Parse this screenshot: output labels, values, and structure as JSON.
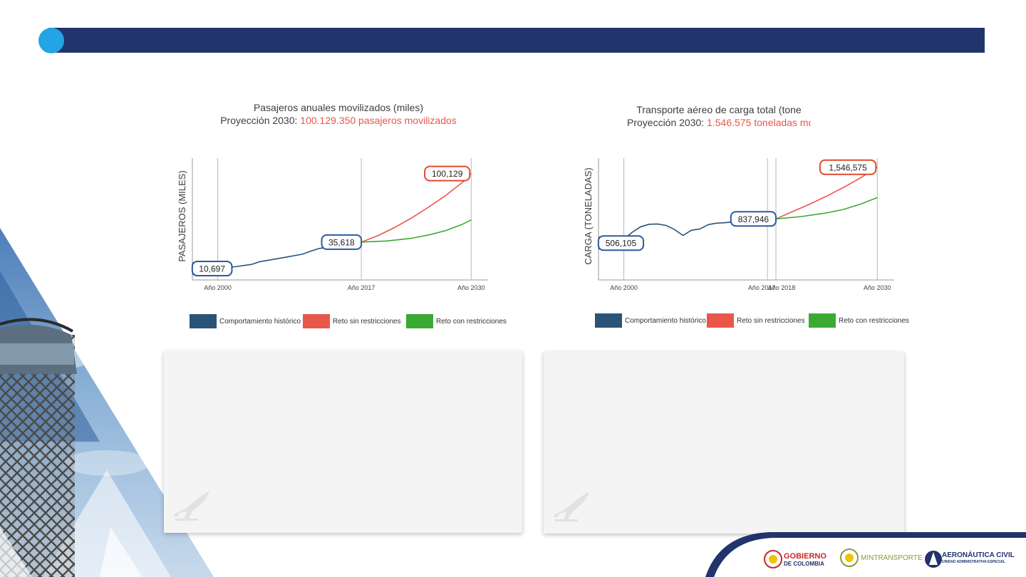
{
  "colors": {
    "header": "#21346b",
    "header_dot": "#23a4e4",
    "historic": "#2a5378",
    "unrestricted": "#e8574a",
    "restricted": "#3aaa35",
    "label_border_blue": "#2c5aa0",
    "label_border_red": "#e04a2e"
  },
  "chart_data": [
    {
      "type": "line",
      "title": "Pasajeros anuales movilizados (miles)",
      "subtitle_prefix": "Proyección 2030: ",
      "subtitle_highlight": "100.129.350 pasajeros movilizados",
      "ylabel": "PASAJEROS (MILES)",
      "xlabel": "",
      "x_ticks": [
        "Año 2000",
        "Año 2017",
        "Año 2030"
      ],
      "xlim": [
        1997,
        2032
      ],
      "ylim": [
        0,
        120000
      ],
      "series": [
        {
          "name": "Comportamiento histórico",
          "color": "#2a5378",
          "x": [
            1998,
            2000,
            2002,
            2004,
            2005,
            2006,
            2008,
            2010,
            2011,
            2012,
            2013,
            2014,
            2015,
            2016,
            2017
          ],
          "values": [
            10697,
            10900,
            12400,
            14600,
            17200,
            18600,
            21300,
            24200,
            27100,
            29600,
            30800,
            32300,
            33500,
            34600,
            35618
          ]
        },
        {
          "name": "Reto sin restricciones",
          "color": "#e8574a",
          "x": [
            2017,
            2019,
            2021,
            2023,
            2025,
            2027,
            2029,
            2030
          ],
          "values": [
            35618,
            41800,
            49600,
            58600,
            68700,
            79600,
            92000,
            100129
          ]
        },
        {
          "name": "Reto con restricciones",
          "color": "#3aaa35",
          "x": [
            2017,
            2020,
            2023,
            2025,
            2027,
            2029,
            2030
          ],
          "values": [
            35618,
            36700,
            39300,
            42400,
            46500,
            52500,
            56500
          ]
        }
      ],
      "data_labels": [
        {
          "text": "10,697",
          "x": 1998,
          "y": 10697,
          "border": "blue"
        },
        {
          "text": "35,618",
          "x": 2017,
          "y": 35618,
          "border": "blue"
        },
        {
          "text": "100,129",
          "x": 2030,
          "y": 100129,
          "border": "red"
        }
      ],
      "legend": [
        "Comportamiento histórico",
        "Reto sin restricciones",
        "Reto con restricciones"
      ]
    },
    {
      "type": "line",
      "title": "Transporte aéreo de carga total (tone",
      "subtitle_prefix": "Proyección 2030: ",
      "subtitle_highlight": "1.546.575 toneladas mo",
      "ylabel": "CARGA (TONELADAS)",
      "xlabel": "",
      "x_ticks": [
        "Año 2000",
        "Año 2017",
        "Año 2018",
        "Año 2030"
      ],
      "xlim": [
        1997,
        2032
      ],
      "ylim": [
        0,
        1750000
      ],
      "series": [
        {
          "name": "Comportamiento histórico",
          "color": "#2a5378",
          "x": [
            1998,
            2000,
            2001,
            2002,
            2003,
            2004,
            2005,
            2006,
            2007,
            2008,
            2009,
            2010,
            2011,
            2012,
            2013,
            2014,
            2015,
            2016,
            2017,
            2018
          ],
          "values": [
            506105,
            560000,
            655000,
            730000,
            765000,
            768000,
            748000,
            692000,
            610000,
            682000,
            700000,
            760000,
            780000,
            786000,
            798000,
            808000,
            818000,
            825000,
            832000,
            837946
          ]
        },
        {
          "name": "Reto sin restricciones",
          "color": "#e8574a",
          "x": [
            2018,
            2020,
            2022,
            2024,
            2026,
            2028,
            2030
          ],
          "values": [
            837946,
            940000,
            1040000,
            1150000,
            1270000,
            1400000,
            1546575
          ]
        },
        {
          "name": "Reto con restricciones",
          "color": "#3aaa35",
          "x": [
            2018,
            2021,
            2024,
            2026,
            2028,
            2030
          ],
          "values": [
            837946,
            870000,
            920000,
            968000,
            1040000,
            1130000
          ]
        }
      ],
      "data_labels": [
        {
          "text": "506,105",
          "x": 1998,
          "y": 506105,
          "border": "blue"
        },
        {
          "text": "837,946",
          "x": 2018,
          "y": 837946,
          "border": "blue"
        },
        {
          "text": "1,546,575",
          "x": 2030,
          "y": 1546575,
          "border": "red"
        }
      ],
      "legend": [
        "Comportamiento histórico",
        "Reto sin restricciones",
        "Reto con restricciones"
      ]
    }
  ],
  "logos": {
    "gobierno_line1": "GOBIERNO",
    "gobierno_line2": "DE COLOMBIA",
    "mintransporte": "MINTRANSPORTE",
    "aero_line1": "AERONÁUTICA CIVIL",
    "aero_line2": "UNIDAD ADMINISTRATIVA ESPECIAL"
  }
}
